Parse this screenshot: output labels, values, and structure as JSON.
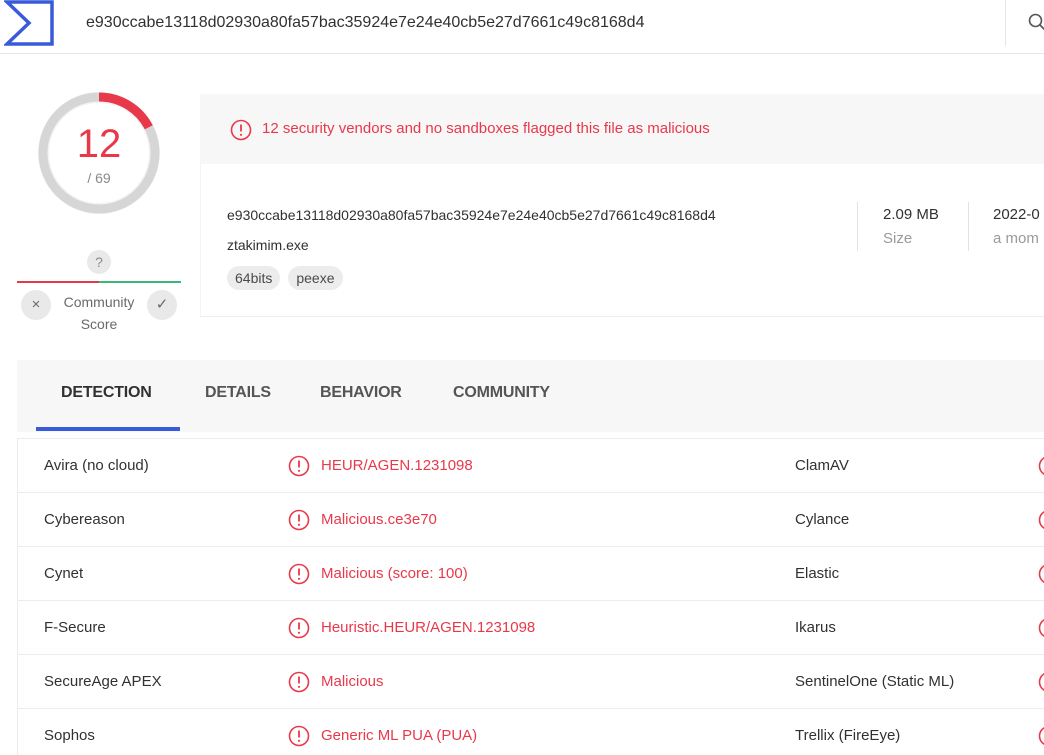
{
  "search": {
    "value": "e930ccabe13118d02930a80fa57bac35924e7e24e40cb5e27d7661c49c8168d4",
    "icon": "search-icon"
  },
  "score": {
    "detections": "12",
    "total": "/ 69",
    "fraction": 0.1739,
    "accent": "#e8394b"
  },
  "community": {
    "question": "?",
    "label": "Community Score",
    "negative_icon": "×",
    "positive_icon": "✓"
  },
  "alert": {
    "text": "12 security vendors and no sandboxes flagged this file as malicious"
  },
  "file": {
    "hash": "e930ccabe13118d02930a80fa57bac35924e7e24e40cb5e27d7661c49c8168d4",
    "name": "ztakimim.exe",
    "tags": [
      "64bits",
      "peexe"
    ],
    "size_value": "2.09 MB",
    "size_label": "Size",
    "date_value": "2022-0",
    "date_label": "a mom"
  },
  "tabs": [
    "DETECTION",
    "DETAILS",
    "BEHAVIOR",
    "COMMUNITY"
  ],
  "detections": [
    {
      "vendor": "Avira (no cloud)",
      "result": "HEUR/AGEN.1231098",
      "vendor2": "ClamAV"
    },
    {
      "vendor": "Cybereason",
      "result": "Malicious.ce3e70",
      "vendor2": "Cylance"
    },
    {
      "vendor": "Cynet",
      "result": "Malicious (score: 100)",
      "vendor2": "Elastic"
    },
    {
      "vendor": "F-Secure",
      "result": "Heuristic.HEUR/AGEN.1231098",
      "vendor2": "Ikarus"
    },
    {
      "vendor": "SecureAge APEX",
      "result": "Malicious",
      "vendor2": "SentinelOne (Static ML)"
    },
    {
      "vendor": "Sophos",
      "result": "Generic ML PUA (PUA)",
      "vendor2": "Trellix (FireEye)"
    }
  ]
}
